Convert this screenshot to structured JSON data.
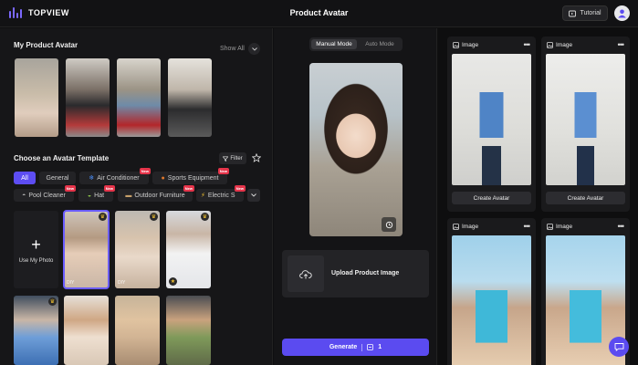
{
  "app": {
    "brand": "TOPVIEW",
    "page_title": "Product Avatar",
    "tutorial_label": "Tutorial"
  },
  "my_avatar": {
    "title": "My Product Avatar",
    "show_all": "Show All"
  },
  "template": {
    "title": "Choose an Avatar Template",
    "filter_label": "Filter",
    "chips": [
      {
        "label": "All",
        "new": false
      },
      {
        "label": "General",
        "new": false
      },
      {
        "label": "Air Conditioner",
        "new": true
      },
      {
        "label": "Sports Equipment",
        "new": true
      },
      {
        "label": "Pool Cleaner",
        "new": true
      },
      {
        "label": "Hat",
        "new": true
      },
      {
        "label": "Outdoor Furniture",
        "new": true
      },
      {
        "label": "Electric S",
        "new": true
      }
    ],
    "new_badge": "New",
    "upload_label": "Use My Photo",
    "diy_label": "DIY"
  },
  "center": {
    "modes": [
      "Manual Mode",
      "Auto Mode"
    ],
    "upload_product_label": "Upload Product Image",
    "generate_label": "Generate",
    "generate_cost": "1"
  },
  "results": {
    "card_label": "Image",
    "create_label": "Create Avatar"
  },
  "colors": {
    "accent": "#5b4bf0",
    "new_badge": "#e5344a",
    "panel": "#161618"
  }
}
